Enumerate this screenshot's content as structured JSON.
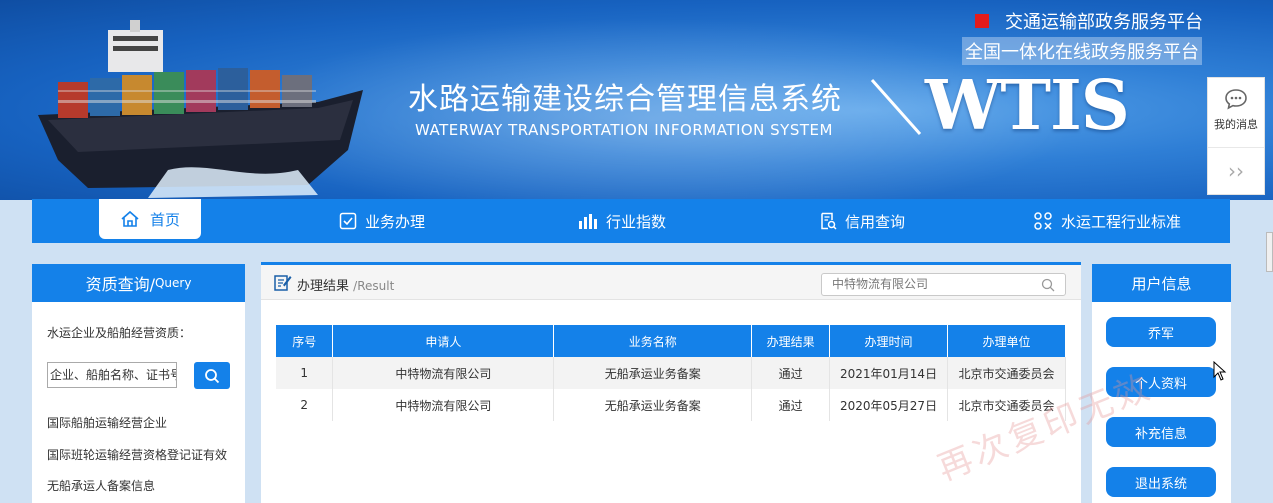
{
  "header": {
    "top_link_1": "交通运输部政务服务平台",
    "top_link_2": "全国一体化在线政务服务平台",
    "title_cn": "水路运输建设综合管理信息系统",
    "title_en": "WATERWAY TRANSPORTATION INFORMATION SYSTEM",
    "logo_text": "WTIS",
    "accent_color": "#1481e9"
  },
  "float_panel": {
    "messages_label": "我的消息",
    "collapse_glyph": "››"
  },
  "nav": {
    "items": [
      {
        "label": "首页",
        "icon": "home-icon"
      },
      {
        "label": "业务办理",
        "icon": "checklist-icon"
      },
      {
        "label": "行业指数",
        "icon": "bar-chart-icon"
      },
      {
        "label": "信用查询",
        "icon": "document-search-icon"
      },
      {
        "label": "水运工程行业标准",
        "icon": "settings-grid-icon"
      }
    ]
  },
  "left_panel": {
    "title": "资质查询/",
    "title_suffix": "Query",
    "description": "水运企业及船舶经营资质：",
    "search_placeholder": "企业、船舶名称、证书号（",
    "links": [
      "国际船舶运输经营企业",
      "国际班轮运输经营资格登记证有效",
      "无船承运人备案信息"
    ]
  },
  "center_panel": {
    "title": "办理结果",
    "subtitle": "/Result",
    "search_value": "中特物流有限公司",
    "table": {
      "columns": [
        "序号",
        "申请人",
        "业务名称",
        "办理结果",
        "办理时间",
        "办理单位"
      ],
      "rows": [
        [
          "1",
          "中特物流有限公司",
          "无船承运业务备案",
          "通过",
          "2021年01月14日",
          "北京市交通委员会"
        ],
        [
          "2",
          "中特物流有限公司",
          "无船承运业务备案",
          "通过",
          "2020年05月27日",
          "北京市交通委员会"
        ]
      ]
    }
  },
  "right_panel": {
    "title": "用户信息",
    "buttons": [
      "乔军",
      "个人资料",
      "补充信息",
      "退出系统"
    ]
  },
  "watermark": "再次复印无效"
}
